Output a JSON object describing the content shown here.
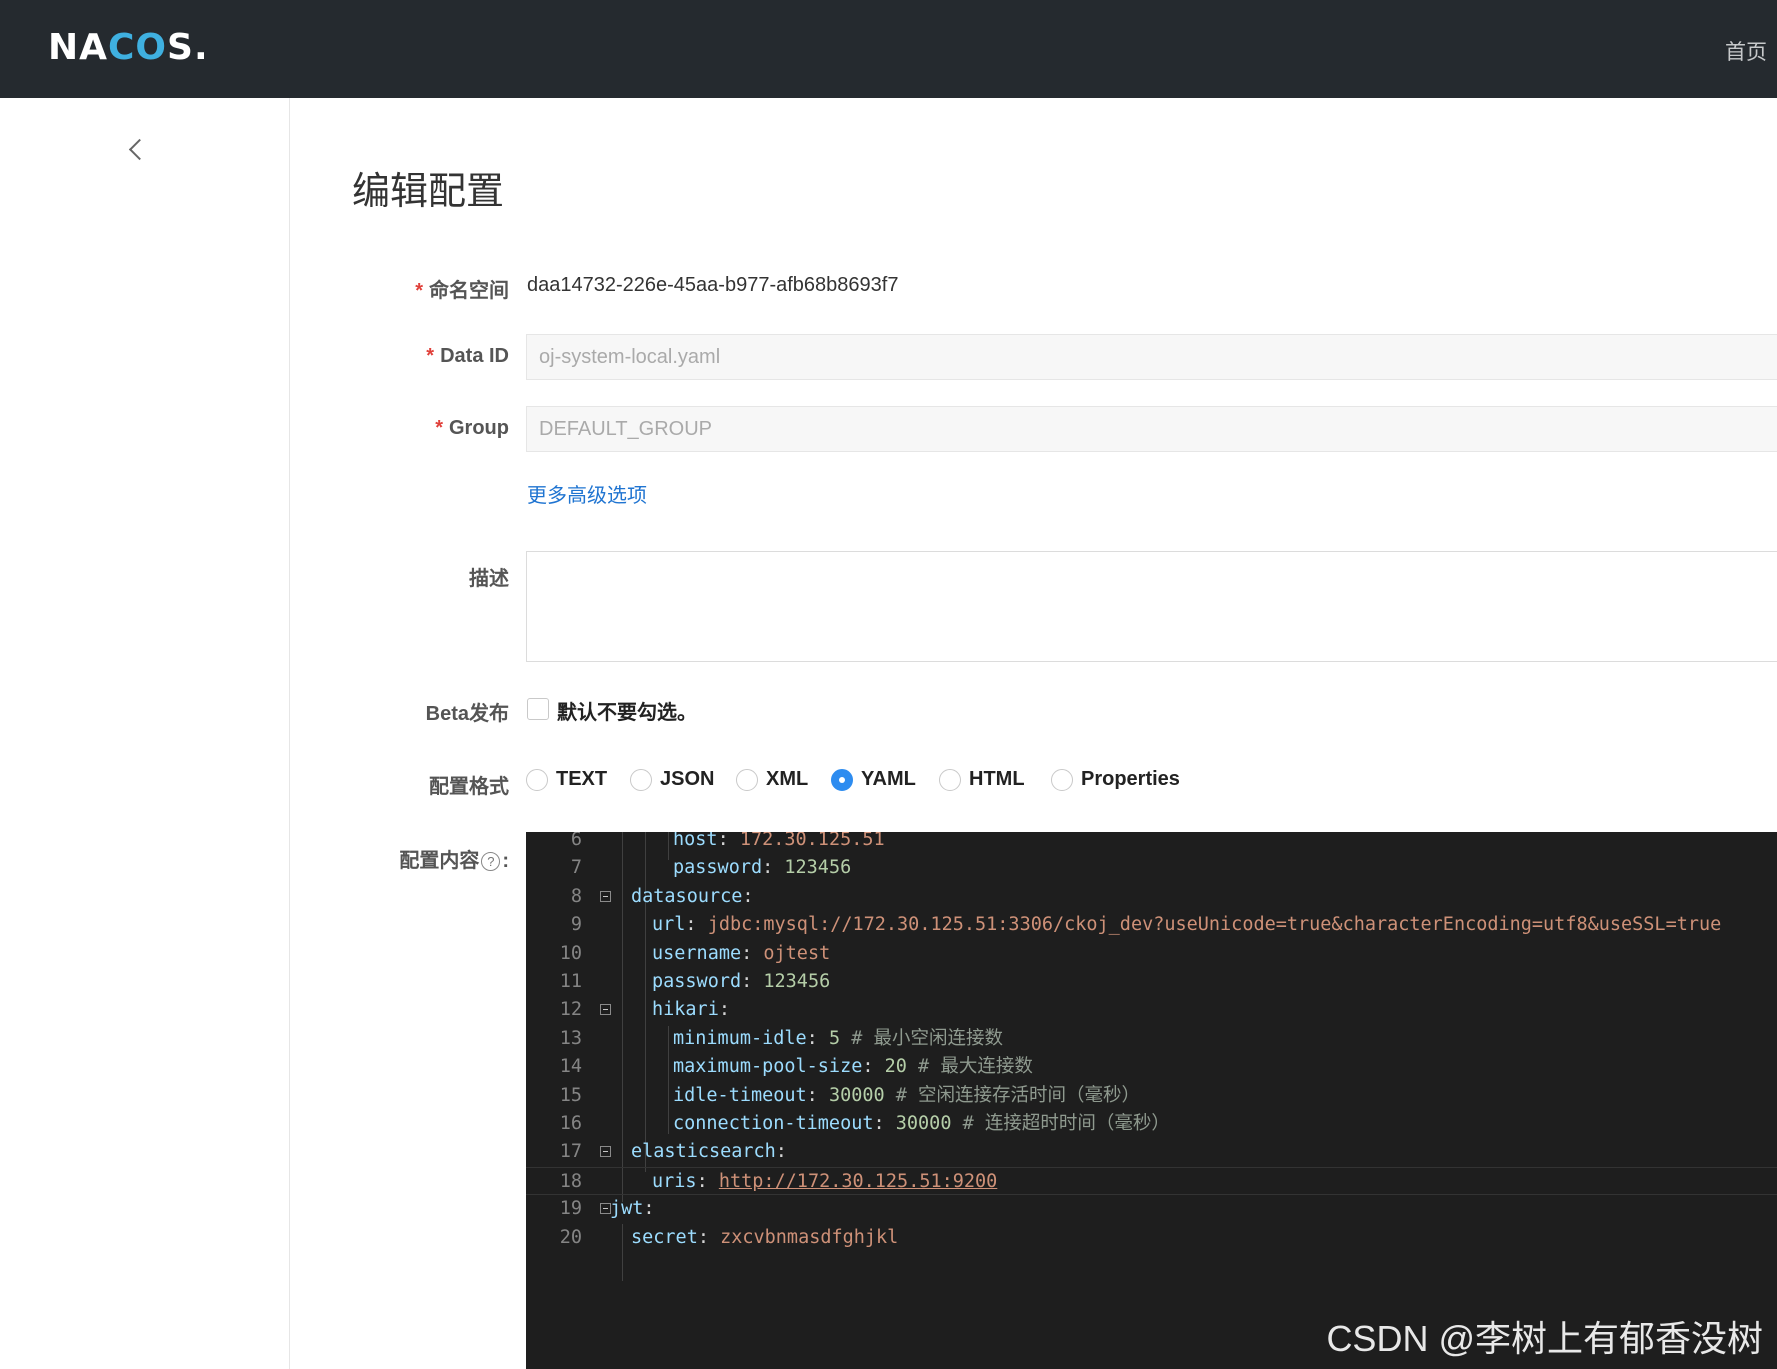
{
  "header": {
    "logo_prefix": "NA",
    "logo_mid": "CO",
    "logo_suffix": "S.",
    "home_label": "首页"
  },
  "page": {
    "title": "编辑配置"
  },
  "form": {
    "required_mark": "*",
    "namespace": {
      "label": "命名空间",
      "value": "daa14732-226e-45aa-b977-afb68b8693f7"
    },
    "data_id": {
      "label": "Data ID",
      "value": "oj-system-local.yaml"
    },
    "group": {
      "label": "Group",
      "value": "DEFAULT_GROUP"
    },
    "advanced_link": "更多高级选项",
    "description": {
      "label": "描述",
      "value": ""
    },
    "beta": {
      "label": "Beta发布",
      "checkbox_text": "默认不要勾选。",
      "checked": false
    },
    "format": {
      "label": "配置格式",
      "options": [
        "TEXT",
        "JSON",
        "XML",
        "YAML",
        "HTML",
        "Properties"
      ],
      "selected": "YAML"
    },
    "content": {
      "label": "配置内容",
      "help_glyph": "?",
      "colon": ":"
    }
  },
  "editor": {
    "lines": [
      {
        "n": "6",
        "key": "host",
        "sep": ": ",
        "val": "172.30.125.51",
        "vtype": "s"
      },
      {
        "n": "7",
        "key": "password",
        "sep": ": ",
        "val": "123456",
        "vtype": "n"
      },
      {
        "n": "8",
        "key": "datasource",
        "sep": ":"
      },
      {
        "n": "9",
        "key": "url",
        "sep": ": ",
        "val": "jdbc:mysql://172.30.125.51:3306/ckoj_dev?useUnicode=true&characterEncoding=utf8&useSSL=true",
        "vtype": "s"
      },
      {
        "n": "10",
        "key": "username",
        "sep": ": ",
        "val": "ojtest",
        "vtype": "s"
      },
      {
        "n": "11",
        "key": "password",
        "sep": ": ",
        "val": "123456",
        "vtype": "n"
      },
      {
        "n": "12",
        "key": "hikari",
        "sep": ":"
      },
      {
        "n": "13",
        "key": "minimum-idle",
        "sep": ": ",
        "val": "5",
        "vtype": "n",
        "comment": " # 最小空闲连接数"
      },
      {
        "n": "14",
        "key": "maximum-pool-size",
        "sep": ": ",
        "val": "20",
        "vtype": "n",
        "comment": " # 最大连接数"
      },
      {
        "n": "15",
        "key": "idle-timeout",
        "sep": ": ",
        "val": "30000",
        "vtype": "n",
        "comment": " # 空闲连接存活时间（毫秒）"
      },
      {
        "n": "16",
        "key": "connection-timeout",
        "sep": ": ",
        "val": "30000",
        "vtype": "n",
        "comment": " # 连接超时时间（毫秒）"
      },
      {
        "n": "17",
        "key": "elasticsearch",
        "sep": ":"
      },
      {
        "n": "18",
        "key": "uris",
        "sep": ": ",
        "val": "http://172.30.125.51:9200",
        "vtype": "u"
      },
      {
        "n": "19",
        "key": "jwt",
        "sep": ":"
      },
      {
        "n": "20",
        "key": "secret",
        "sep": ": ",
        "val": "zxcvbnmasdfghjkl",
        "vtype": "s"
      }
    ]
  },
  "watermark": "CSDN @李树上有郁香没树"
}
